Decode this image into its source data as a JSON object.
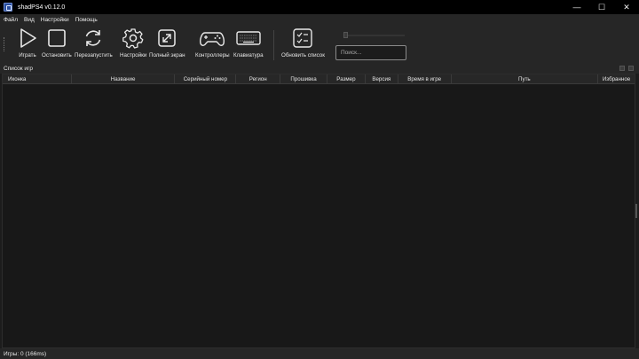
{
  "window": {
    "title": "shadPS4 v0.12.0",
    "minimize": "—",
    "maximize": "☐",
    "close": "✕"
  },
  "menu": [
    "Файл",
    "Вид",
    "Настройки",
    "Помощь"
  ],
  "toolbar": {
    "play": "Играть",
    "stop": "Остановить",
    "restart": "Перезапустить",
    "settings": "Настройки",
    "fullscreen": "Полный экран",
    "controllers": "Контроллеры",
    "keyboard": "Клавиатура",
    "refresh": "Обновить список",
    "search_placeholder": "Поиск..."
  },
  "dock": {
    "title": "Список игр"
  },
  "table": {
    "columns": [
      "Иконка",
      "Название",
      "Серийный номер",
      "Регион",
      "Прошивка",
      "Размер",
      "Версия",
      "Время в игре",
      "Путь",
      "Избранное"
    ],
    "rows": []
  },
  "status": {
    "text": "Игры: 0 (166ms)"
  },
  "colors": {
    "background": "#1c1c1c",
    "titlebar": "#000000",
    "panel": "#262626",
    "accent": "#2a4f9f"
  }
}
